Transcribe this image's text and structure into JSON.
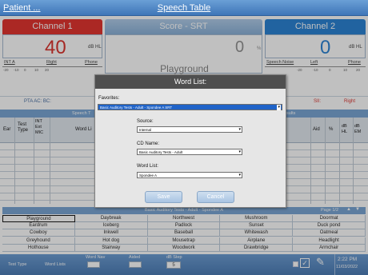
{
  "header": {
    "patient": "Patient ...",
    "title": "Speech Table"
  },
  "channel1": {
    "title": "Channel 1",
    "level": "40",
    "unit": "dB HL",
    "transducer": "INT A",
    "ear": "Right",
    "device": "Phone",
    "color": "#e0201a"
  },
  "score": {
    "title": "Score - SRT",
    "value": "0",
    "unit": "%",
    "word": "Playground"
  },
  "channel2": {
    "title": "Channel 2",
    "level": "0",
    "unit": "dB HL",
    "transducer": "Speech Noise",
    "ear": "Left",
    "device": "Phone",
    "color": "#1577d0"
  },
  "ticks_left": [
    "-20",
    "-10",
    "0",
    "10",
    "20"
  ],
  "ticks_right": [
    "-20",
    "-10",
    "0",
    "10",
    "20"
  ],
  "pta": {
    "label": "PTA AC: BC:",
    "sii": "SII:",
    "right": "Right"
  },
  "grid": {
    "left_title": "Speech T",
    "right_title": "esults",
    "headers": {
      "ear": "Ear",
      "test_type": "Test Type",
      "int": "INT Ext MIC",
      "word": "Word Li",
      "aid": "Aid",
      "pct": "%",
      "db_hl": "dB HL",
      "db_em": "dB EM"
    }
  },
  "word_table": {
    "title": "Basic Auditory Tests - Adult - Spondee A",
    "page": "Page 1/2",
    "rows": [
      [
        "Playground",
        "Daybreak",
        "Northwest",
        "Mushroom",
        "Doormat"
      ],
      [
        "Eardrum",
        "Iceberg",
        "Padlock",
        "Sunset",
        "Duck pond"
      ],
      [
        "Cowboy",
        "Inkwell",
        "Baseball",
        "Whitewash",
        "Oatmeal"
      ],
      [
        "Greyhound",
        "Hot dog",
        "Mousetrap",
        "Airplane",
        "Headlight"
      ],
      [
        "Hothouse",
        "Stairway",
        "Woodwork",
        "Drawbridge",
        "Armchair"
      ]
    ]
  },
  "dialog": {
    "title": "Word List:",
    "favorites_label": "Favorites:",
    "favorites_value": "Basic Auditory Tests - Adult - Spondee A  SRT",
    "source_label": "Source:",
    "source_value": "Internal",
    "cd_label": "CD Name:",
    "cd_value": "Basic Auditory Tests - Adult",
    "wordlist_label": "Word List:",
    "wordlist_value": "Spondee A",
    "save": "Save",
    "cancel": "Cancel"
  },
  "footer": {
    "test_type": "Test Type",
    "word_lists": "Word Lists",
    "word_nav": "Word Nav",
    "aided": "Aided",
    "db_step": "dB Step",
    "db_step_value": "5",
    "time": "2:22 PM",
    "date": "11/03/2022"
  },
  "colors": {
    "blue": "#3f76b8",
    "red": "#e0201a",
    "channel2": "#1577d0",
    "grid_band": "#6c9dd0"
  }
}
